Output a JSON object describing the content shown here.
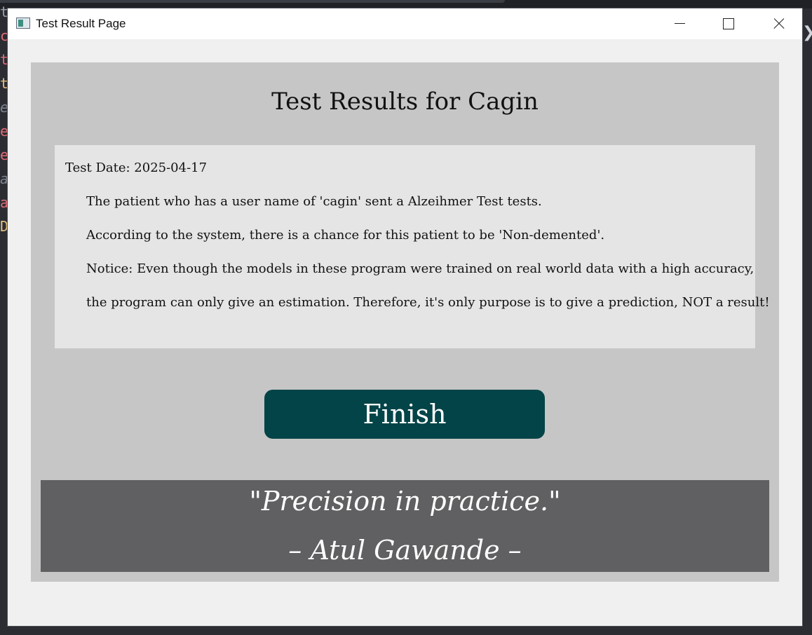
{
  "window": {
    "title": "Test Result Page"
  },
  "page": {
    "heading": "Test Results for Cagin",
    "test_date": "Test Date: 2025-04-17",
    "paragraphs": [
      "The patient who has a user name of 'cagin' sent a Alzeihmer Test tests.",
      "According to the system, there is a chance for this patient to be 'Non-demented'.",
      "Notice: Even though the models in these program were trained on real world data with a high accuracy,",
      "the program can only give an estimation. Therefore, it's only purpose is to give a prediction, NOT a result!"
    ],
    "finish_label": "Finish",
    "quote": "\"Precision in practice.\"",
    "author": "– Atul Gawande –"
  },
  "background_code_letters": [
    "t",
    "c",
    "t",
    "t",
    "e",
    "e",
    "e",
    "a",
    "a",
    "D"
  ],
  "colors": {
    "finish_button": "#024447",
    "panel": "#c6c6c6",
    "result_box": "#e5e5e5",
    "quote_box": "#606062"
  }
}
